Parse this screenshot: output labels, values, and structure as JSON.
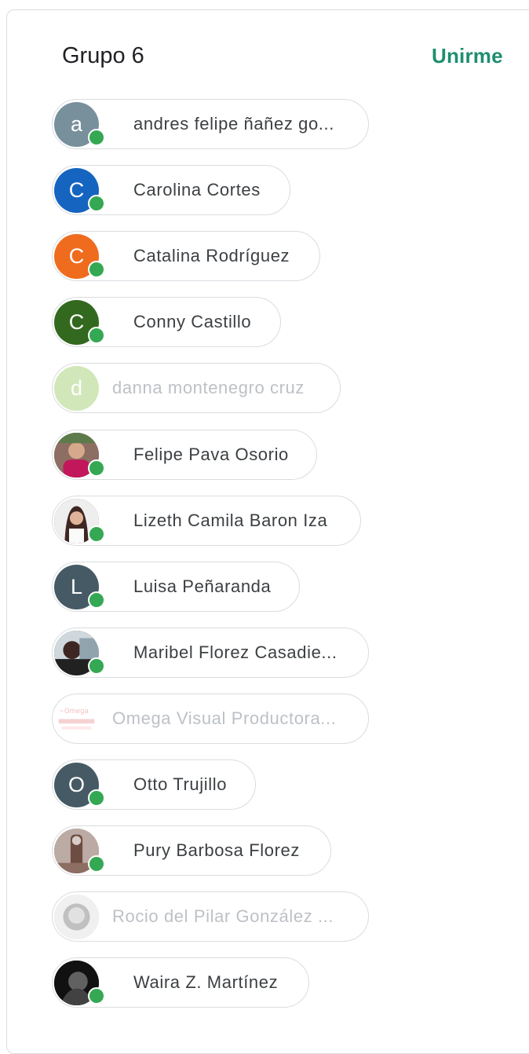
{
  "group": {
    "title": "Grupo 6",
    "join_label": "Unirme"
  },
  "members": [
    {
      "name": "andres felipe ñañez go...",
      "initial": "a",
      "avatar_color": "#78909c",
      "online": true,
      "inactive": false
    },
    {
      "name": "Carolina Cortes",
      "initial": "C",
      "avatar_color": "#1565c0",
      "online": true,
      "inactive": false
    },
    {
      "name": "Catalina Rodríguez",
      "initial": "C",
      "avatar_color": "#ef6c1f",
      "online": true,
      "inactive": false
    },
    {
      "name": "Conny Castillo",
      "initial": "C",
      "avatar_color": "#33691e",
      "online": true,
      "inactive": false
    },
    {
      "name": "danna montenegro cruz",
      "initial": "d",
      "avatar_color": "#9ccc65",
      "online": false,
      "inactive": true
    },
    {
      "name": "Felipe Pava Osorio",
      "initial": "",
      "avatar_color": "#8d6e63",
      "online": true,
      "inactive": false,
      "photo": true
    },
    {
      "name": "Lizeth Camila Baron Iza",
      "initial": "",
      "avatar_color": "#5d4037",
      "online": true,
      "inactive": false,
      "photo": true
    },
    {
      "name": "Luisa Peñaranda",
      "initial": "L",
      "avatar_color": "#455a64",
      "online": true,
      "inactive": false
    },
    {
      "name": "Maribel Florez Casadie...",
      "initial": "",
      "avatar_color": "#4e342e",
      "online": true,
      "inactive": false,
      "photo": true
    },
    {
      "name": "Omega Visual Productora...",
      "initial": "",
      "avatar_color": "#ffffff",
      "online": false,
      "inactive": true,
      "photo": true
    },
    {
      "name": "Otto Trujillo",
      "initial": "O",
      "avatar_color": "#455a64",
      "online": true,
      "inactive": false
    },
    {
      "name": "Pury Barbosa Florez",
      "initial": "",
      "avatar_color": "#a1887f",
      "online": true,
      "inactive": false,
      "photo": true
    },
    {
      "name": "Rocio del Pilar González ...",
      "initial": "",
      "avatar_color": "#9e9e9e",
      "online": false,
      "inactive": true,
      "photo": true
    },
    {
      "name": "Waira Z. Martínez",
      "initial": "",
      "avatar_color": "#212121",
      "online": true,
      "inactive": false,
      "photo": true
    }
  ]
}
